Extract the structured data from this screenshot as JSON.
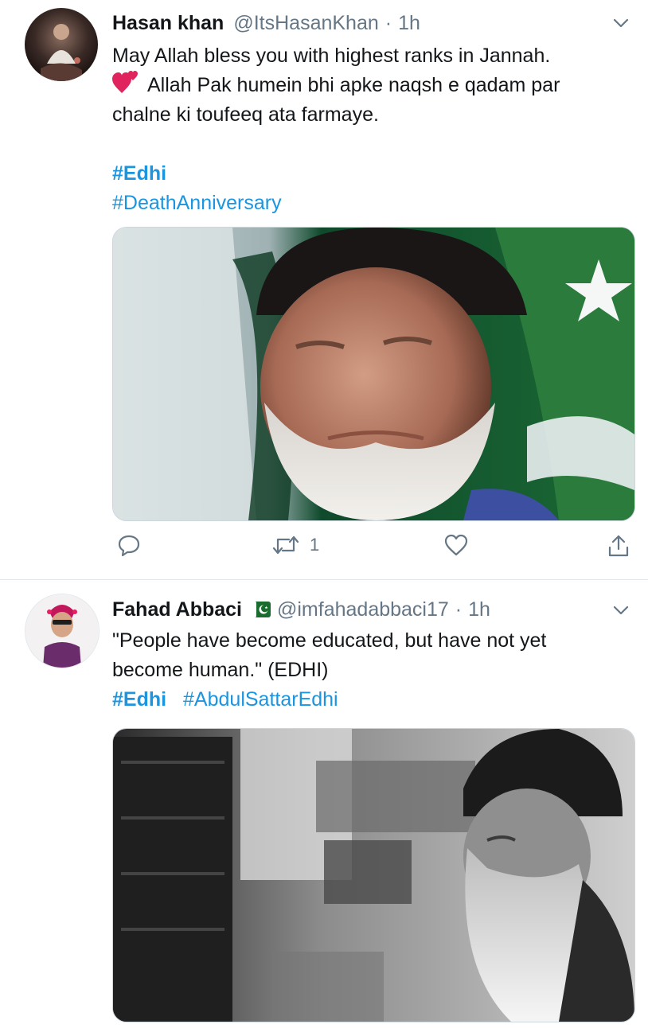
{
  "tweets": [
    {
      "name": "Hasan khan",
      "handle": "@ItsHasanKhan",
      "separator": "·",
      "time": "1h",
      "lines": [
        "May Allah bless you with highest ranks in Jannah.",
        "Allah Pak humein bhi apke naqsh e qadam par",
        "chalne ki toufeeq ata farmaye."
      ],
      "line2_emoji": "two-hearts-emoji",
      "hashtags": [
        "#Edhi",
        "#DeathAnniversary"
      ],
      "media_icon": "portrait-with-pakistan-flag",
      "actions": {
        "reply_count": "",
        "retweet_count": "1",
        "like_count": ""
      }
    },
    {
      "name": "Fahad Abbaci",
      "name_badge": "pakistan-flag-emoji",
      "handle": "@imfahadabbaci17",
      "separator": "·",
      "time": "1h",
      "lines": [
        "\"People have become educated, but have not yet",
        "become human.\" (EDHI)"
      ],
      "hashtags": [
        "#Edhi",
        "#AbdulSattarEdhi"
      ],
      "media_icon": "black-and-white-portrait"
    }
  ],
  "colors": {
    "link": "#1b95e0",
    "secondary": "#657786",
    "divider": "#e1e8ed"
  }
}
